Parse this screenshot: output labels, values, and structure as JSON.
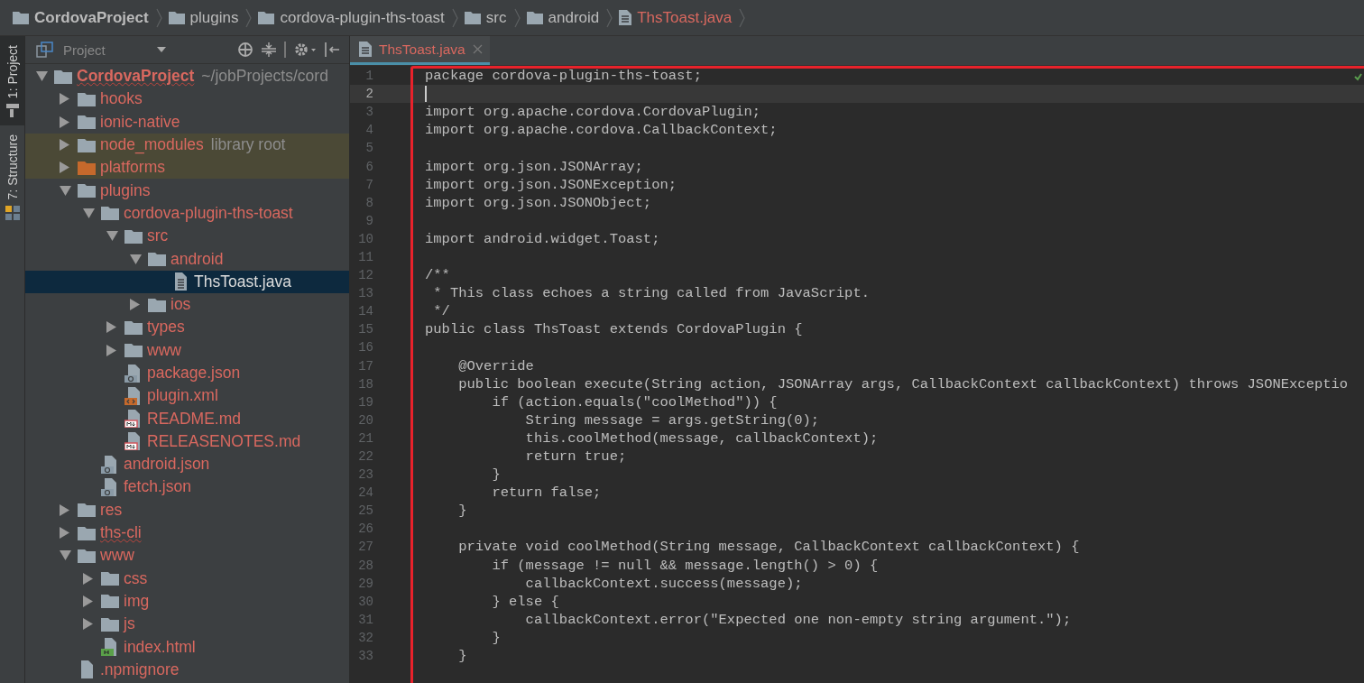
{
  "breadcrumbs": [
    {
      "label": "CordovaProject",
      "kind": "folder"
    },
    {
      "label": "plugins",
      "kind": "folder"
    },
    {
      "label": "cordova-plugin-ths-toast",
      "kind": "folder"
    },
    {
      "label": "src",
      "kind": "folder"
    },
    {
      "label": "android",
      "kind": "folder"
    },
    {
      "label": "ThsToast.java",
      "kind": "file"
    }
  ],
  "tool_strip": [
    {
      "label": "1: Project",
      "selected": true
    },
    {
      "label": "7: Structure",
      "selected": false
    }
  ],
  "project_panel": {
    "view": "Project",
    "tree": [
      {
        "label": "CordovaProject",
        "hint": "~/jobProjects/cord",
        "kind": "folder",
        "expanded": true,
        "selected": false,
        "misspelled": true,
        "highlighted": false,
        "children": [
          {
            "label": "hooks",
            "kind": "folder",
            "expanded": false,
            "selected": false,
            "misspelled": false,
            "highlighted": false
          },
          {
            "label": "ionic-native",
            "kind": "folder",
            "expanded": false,
            "selected": false,
            "misspelled": false,
            "highlighted": false
          },
          {
            "label": "node_modules",
            "hint": "library root",
            "kind": "folder",
            "expanded": false,
            "selected": false,
            "misspelled": false,
            "highlighted": true
          },
          {
            "label": "platforms",
            "kind": "special-folder",
            "expanded": false,
            "selected": false,
            "misspelled": false,
            "highlighted": true
          },
          {
            "label": "plugins",
            "kind": "folder",
            "expanded": true,
            "selected": false,
            "misspelled": false,
            "highlighted": false,
            "children": [
              {
                "label": "cordova-plugin-ths-toast",
                "kind": "folder",
                "expanded": true,
                "selected": false,
                "misspelled": false,
                "highlighted": false,
                "children": [
                  {
                    "label": "src",
                    "kind": "folder",
                    "expanded": true,
                    "selected": false,
                    "misspelled": false,
                    "highlighted": false,
                    "children": [
                      {
                        "label": "android",
                        "kind": "folder",
                        "expanded": true,
                        "selected": false,
                        "misspelled": false,
                        "highlighted": false,
                        "children": [
                          {
                            "label": "ThsToast.java",
                            "kind": "java-file",
                            "selected": true,
                            "misspelled": false,
                            "highlighted": false
                          }
                        ]
                      },
                      {
                        "label": "ios",
                        "kind": "folder",
                        "expanded": false,
                        "selected": false,
                        "misspelled": false,
                        "highlighted": false
                      }
                    ]
                  },
                  {
                    "label": "types",
                    "kind": "folder",
                    "expanded": false,
                    "selected": false,
                    "misspelled": false,
                    "highlighted": false
                  },
                  {
                    "label": "www",
                    "kind": "folder",
                    "expanded": false,
                    "selected": false,
                    "misspelled": false,
                    "highlighted": false
                  },
                  {
                    "label": "package.json",
                    "kind": "json-file",
                    "selected": false,
                    "misspelled": false,
                    "highlighted": false
                  },
                  {
                    "label": "plugin.xml",
                    "kind": "xml-file",
                    "selected": false,
                    "misspelled": false,
                    "highlighted": false
                  },
                  {
                    "label": "README.md",
                    "kind": "md-file",
                    "selected": false,
                    "misspelled": false,
                    "highlighted": false
                  },
                  {
                    "label": "RELEASENOTES.md",
                    "kind": "md-file",
                    "selected": false,
                    "misspelled": false,
                    "highlighted": false
                  }
                ]
              },
              {
                "label": "android.json",
                "kind": "json-file",
                "selected": false,
                "misspelled": false,
                "highlighted": false
              },
              {
                "label": "fetch.json",
                "kind": "json-file",
                "selected": false,
                "misspelled": false,
                "highlighted": false
              }
            ]
          },
          {
            "label": "res",
            "kind": "folder",
            "expanded": false,
            "selected": false,
            "misspelled": false,
            "highlighted": false
          },
          {
            "label": "ths-cli",
            "kind": "folder",
            "expanded": false,
            "selected": false,
            "misspelled": true,
            "highlighted": false
          },
          {
            "label": "www",
            "kind": "folder",
            "expanded": true,
            "selected": false,
            "misspelled": false,
            "highlighted": false,
            "children": [
              {
                "label": "css",
                "kind": "folder",
                "expanded": false,
                "selected": false,
                "misspelled": false,
                "highlighted": false
              },
              {
                "label": "img",
                "kind": "folder",
                "expanded": false,
                "selected": false,
                "misspelled": false,
                "highlighted": false
              },
              {
                "label": "js",
                "kind": "folder",
                "expanded": false,
                "selected": false,
                "misspelled": false,
                "highlighted": false
              },
              {
                "label": "index.html",
                "kind": "html-file",
                "selected": false,
                "misspelled": false,
                "highlighted": false
              }
            ]
          },
          {
            "label": ".npmignore",
            "kind": "plain-file",
            "selected": false,
            "misspelled": false,
            "highlighted": false
          }
        ]
      }
    ]
  },
  "editor": {
    "tabs": [
      {
        "label": "ThsToast.java",
        "selected": true
      }
    ],
    "lines": [
      {
        "number": "1",
        "text": "package cordova-plugin-ths-toast;",
        "current": false
      },
      {
        "number": "2",
        "current": true
      },
      {
        "number": "3",
        "text": "import org.apache.cordova.CordovaPlugin;",
        "current": false
      },
      {
        "number": "4",
        "text": "import org.apache.cordova.CallbackContext;",
        "current": false
      },
      {
        "number": "5",
        "current": false
      },
      {
        "number": "6",
        "text": "import org.json.JSONArray;",
        "current": false
      },
      {
        "number": "7",
        "text": "import org.json.JSONException;",
        "current": false
      },
      {
        "number": "8",
        "text": "import org.json.JSONObject;",
        "current": false
      },
      {
        "number": "9",
        "current": false
      },
      {
        "number": "10",
        "text": "import android.widget.Toast;",
        "current": false
      },
      {
        "number": "11",
        "current": false
      },
      {
        "number": "12",
        "text": "/**",
        "current": false
      },
      {
        "number": "13",
        "text": " * This class echoes a string called from JavaScript.",
        "current": false
      },
      {
        "number": "14",
        "text": " */",
        "current": false
      },
      {
        "number": "15",
        "text": "public class ThsToast extends CordovaPlugin {",
        "current": false
      },
      {
        "number": "16",
        "current": false
      },
      {
        "number": "17",
        "text": "    @Override",
        "current": false
      },
      {
        "number": "18",
        "text": "    public boolean execute(String action, JSONArray args, CallbackContext callbackContext) throws JSONExceptio",
        "current": false
      },
      {
        "number": "19",
        "text": "        if (action.equals(\"coolMethod\")) {",
        "current": false
      },
      {
        "number": "20",
        "text": "            String message = args.getString(0);",
        "current": false
      },
      {
        "number": "21",
        "text": "            this.coolMethod(message, callbackContext);",
        "current": false
      },
      {
        "number": "22",
        "text": "            return true;",
        "current": false
      },
      {
        "number": "23",
        "text": "        }",
        "current": false
      },
      {
        "number": "24",
        "text": "        return false;",
        "current": false
      },
      {
        "number": "25",
        "text": "    }",
        "current": false
      },
      {
        "number": "26",
        "current": false
      },
      {
        "number": "27",
        "text": "    private void coolMethod(String message, CallbackContext callbackContext) {",
        "current": false
      },
      {
        "number": "28",
        "text": "        if (message != null && message.length() > 0) {",
        "current": false
      },
      {
        "number": "29",
        "text": "            callbackContext.success(message);",
        "current": false
      },
      {
        "number": "30",
        "text": "        } else {",
        "current": false
      },
      {
        "number": "31",
        "text": "            callbackContext.error(\"Expected one non-empty string argument.\");",
        "current": false
      },
      {
        "number": "32",
        "text": "        }",
        "current": false
      },
      {
        "number": "33",
        "text": "    }",
        "current": false
      }
    ]
  }
}
